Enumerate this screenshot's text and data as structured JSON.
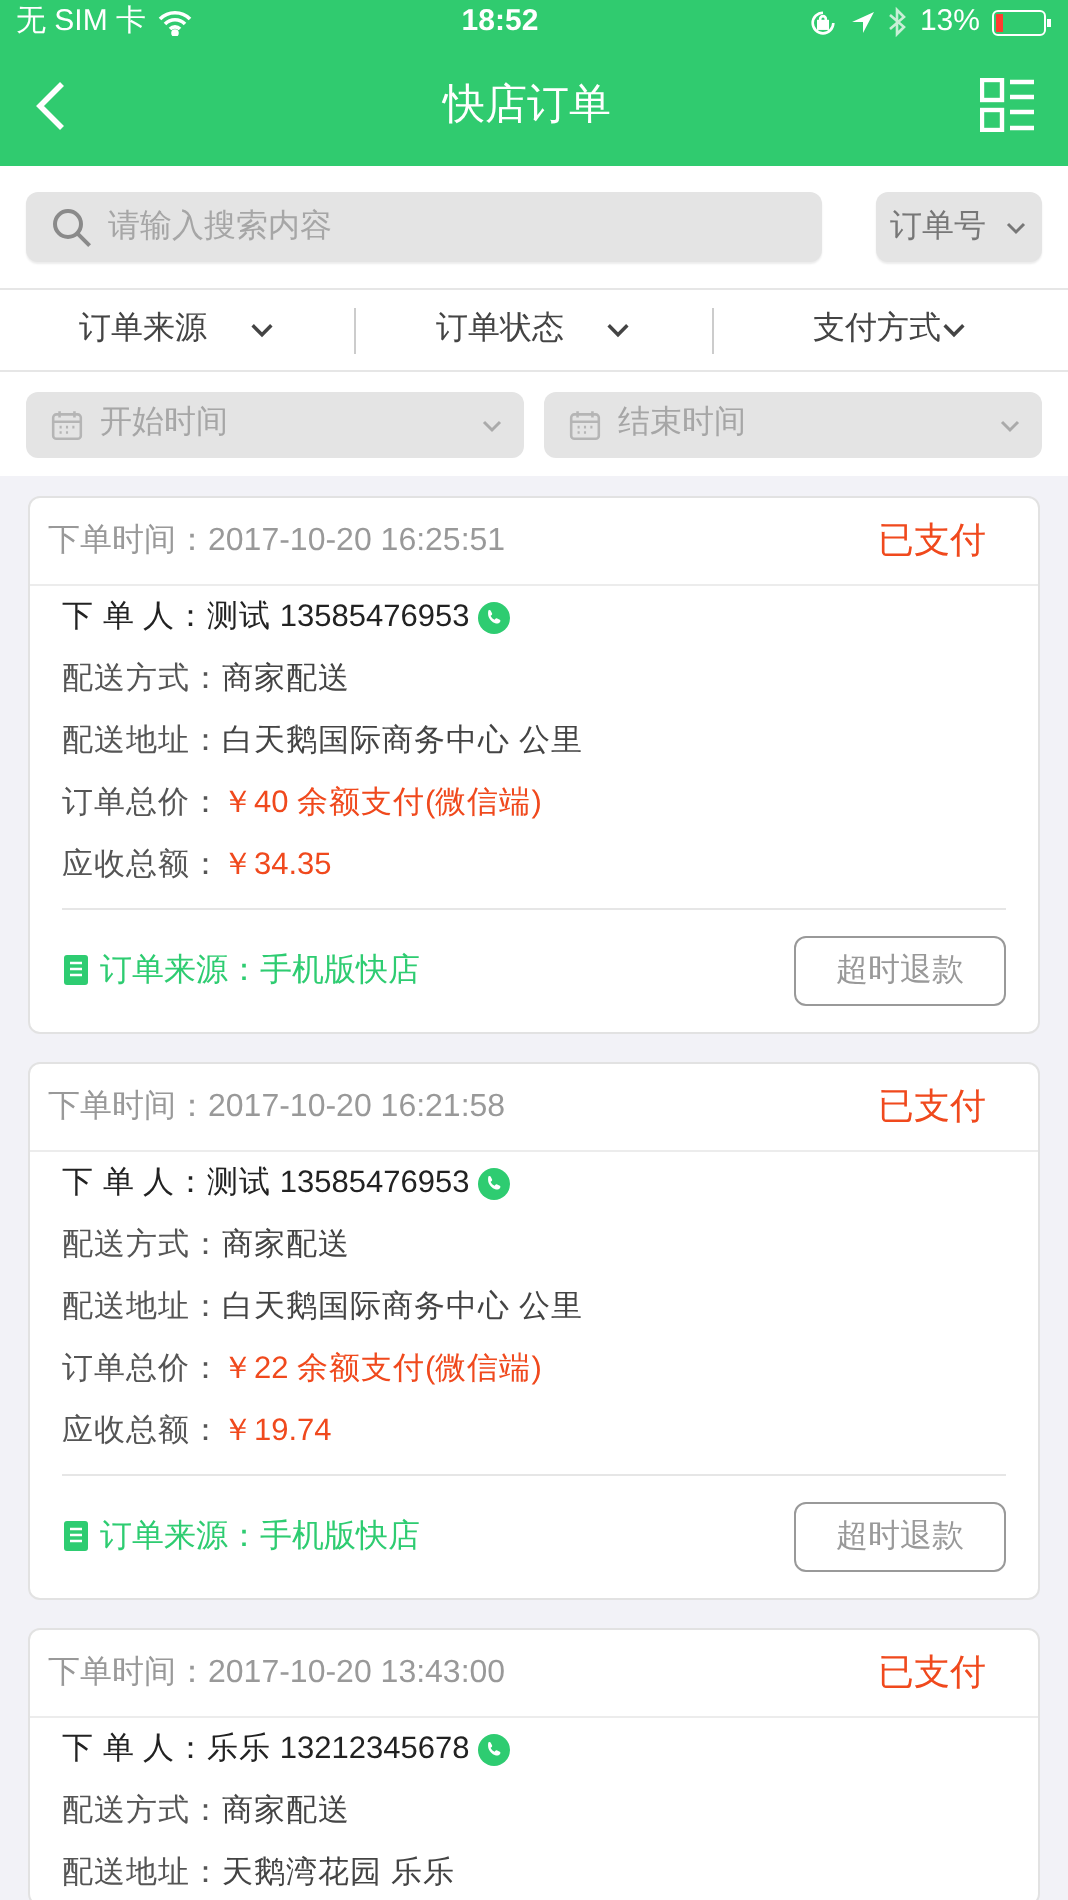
{
  "status_bar": {
    "carrier": "无 SIM 卡",
    "time": "18:52",
    "battery": "13%"
  },
  "nav": {
    "title": "快店订单"
  },
  "search": {
    "placeholder": "请输入搜索内容",
    "search_type": "订单号"
  },
  "filters": [
    {
      "label": "订单来源"
    },
    {
      "label": "订单状态"
    },
    {
      "label": "支付方式"
    }
  ],
  "date_range": [
    {
      "placeholder": "开始时间"
    },
    {
      "placeholder": "结束时间"
    }
  ],
  "orders": [
    {
      "time_label": "下单时间：",
      "time": "2017-10-20 16:25:51",
      "status": "已支付",
      "fields": [
        {
          "kind": "phone",
          "label": "下 单 人：",
          "value": "测试 13585476953"
        },
        {
          "kind": "plain",
          "label": "配送方式：",
          "value": "商家配送"
        },
        {
          "kind": "plain",
          "label": "配送地址：",
          "value": "白天鹅国际商务中心 公里"
        },
        {
          "kind": "price",
          "label": "订单总价：",
          "value": "￥40 余额支付(微信端)"
        },
        {
          "kind": "price",
          "label": "应收总额：",
          "value": "￥34.35"
        }
      ],
      "source": "订单来源：手机版快店",
      "action": "超时退款"
    },
    {
      "time_label": "下单时间：",
      "time": "2017-10-20 16:21:58",
      "status": "已支付",
      "fields": [
        {
          "kind": "phone",
          "label": "下 单 人：",
          "value": "测试 13585476953"
        },
        {
          "kind": "plain",
          "label": "配送方式：",
          "value": "商家配送"
        },
        {
          "kind": "plain",
          "label": "配送地址：",
          "value": "白天鹅国际商务中心 公里"
        },
        {
          "kind": "price",
          "label": "订单总价：",
          "value": "￥22 余额支付(微信端)"
        },
        {
          "kind": "price",
          "label": "应收总额：",
          "value": "￥19.74"
        }
      ],
      "source": "订单来源：手机版快店",
      "action": "超时退款"
    },
    {
      "time_label": "下单时间：",
      "time": "2017-10-20 13:43:00",
      "status": "已支付",
      "fields": [
        {
          "kind": "phone",
          "label": "下 单 人：",
          "value": "乐乐 13212345678"
        },
        {
          "kind": "plain",
          "label": "配送方式：",
          "value": "商家配送"
        },
        {
          "kind": "plain",
          "label": "配送地址：",
          "value": "天鹅湾花园 乐乐"
        }
      ]
    }
  ]
}
